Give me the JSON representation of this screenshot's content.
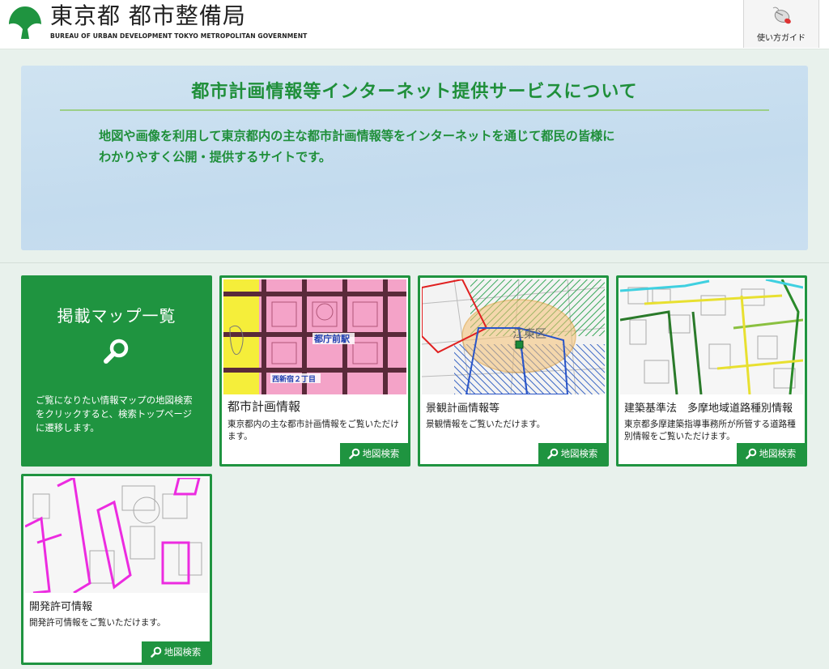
{
  "header": {
    "title": "東京都 都市整備局",
    "subtitle": "BUREAU OF URBAN DEVELOPMENT TOKYO METROPOLITAN GOVERNMENT",
    "guide_label": "使い方ガイド"
  },
  "about": {
    "title": "都市計画情報等インターネット提供サービスについて",
    "line1": "地図や画像を利用して東京都内の主な都市計画情報等をインターネットを通じて都民の皆様に",
    "line2": "わかりやすく公開・提供するサイトです。"
  },
  "intro": {
    "title": "掲載マップ一覧",
    "text": "ご覧になりたい情報マップの地図検索をクリックすると、検索トップページに遷移します。"
  },
  "cards": [
    {
      "title": "都市計画情報",
      "desc": "東京都内の主な都市計画情報をご覧いただけます。",
      "button": "地図検索",
      "map_labels": [
        "都庁前駅",
        "西新宿２丁目"
      ]
    },
    {
      "title": "景観計画情報等",
      "desc": "景観情報をご覧いただけます。",
      "button": "地図検索",
      "map_labels": [
        "江東区"
      ]
    },
    {
      "title": "建築基準法　多摩地域道路種別情報",
      "desc": "東京都多摩建築指導事務所が所管する道路種別情報をご覧いただけます。",
      "button": "地図検索"
    },
    {
      "title": "開発許可情報",
      "desc": "開発許可情報をご覧いただけます。",
      "button": "地図検索"
    }
  ],
  "colors": {
    "brand_green": "#1f9440",
    "about_bg": "#c8dff0",
    "about_text": "#1f8f3a"
  }
}
